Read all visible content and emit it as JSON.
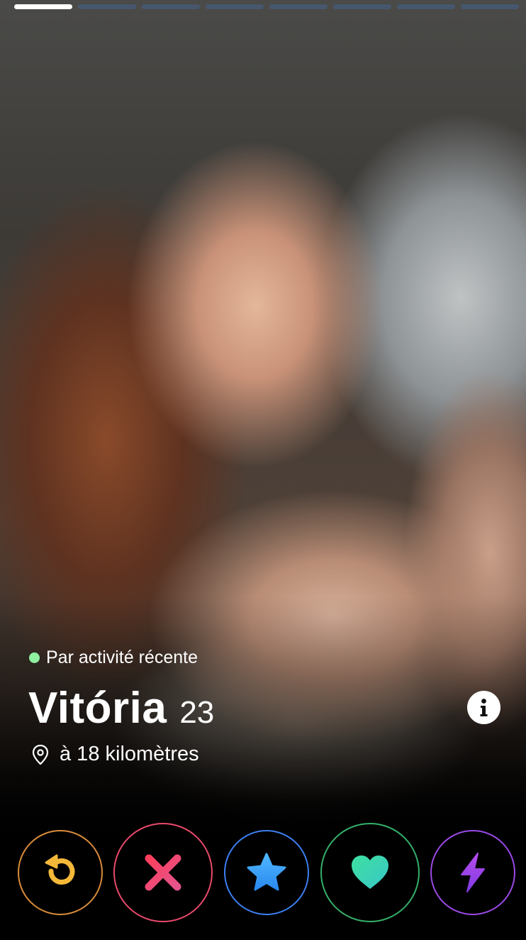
{
  "profile": {
    "activity_status": "Par activité récente",
    "name": "Vitória",
    "age": "23",
    "distance": "à 18 kilomètres"
  },
  "photo_progress": {
    "total": 8,
    "current": 1
  },
  "icons": {
    "pin": "location-pin-icon",
    "info": "info-icon",
    "rewind": "rewind-icon",
    "nope": "close-x-icon",
    "super_like": "star-icon",
    "like": "heart-icon",
    "boost": "lightning-bolt-icon"
  },
  "colors": {
    "online_dot": "#8ef0a0",
    "rewind": "#f5b93a",
    "nope": "#f2476a",
    "super_like": "#3aa8f5",
    "like": "#3ee0b0",
    "boost": "#a847e8"
  }
}
